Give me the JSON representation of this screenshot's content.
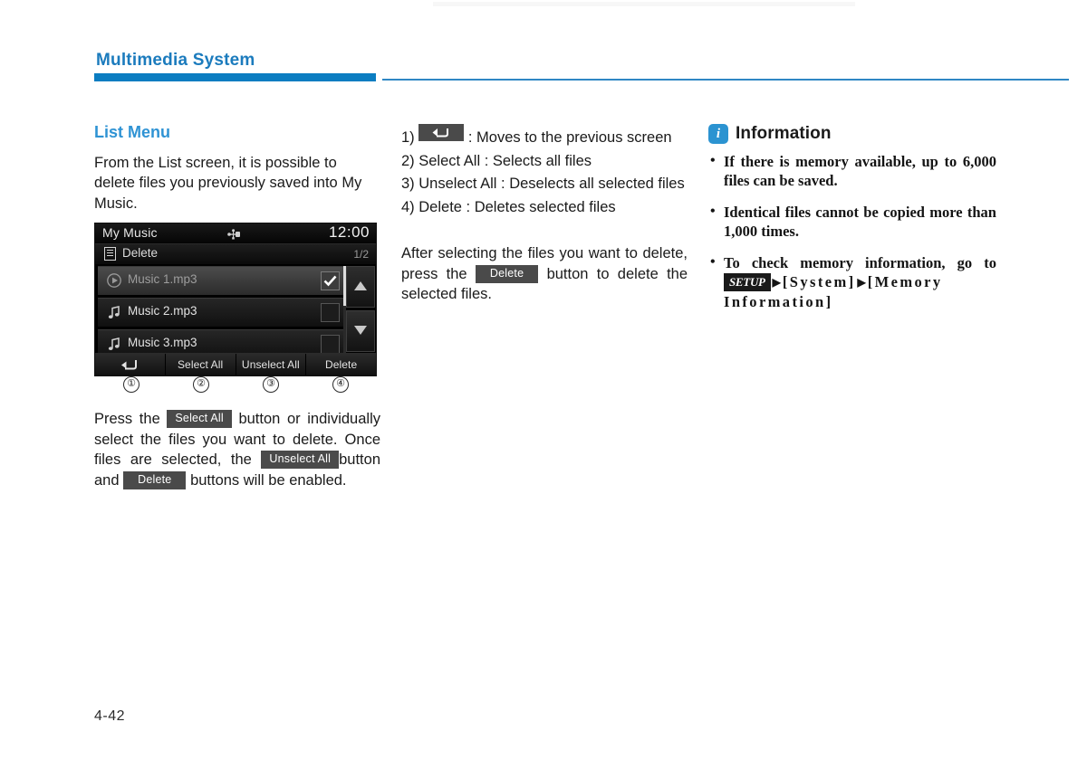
{
  "header": {
    "title": "Multimedia System"
  },
  "left": {
    "section_title": "List Menu",
    "intro": "From the List screen, it is possible to delete files you previously saved into My Music.",
    "under_device": {
      "part1": "Press the",
      "chip_select_all": "Select All",
      "part2": "button or individually select the files you want to delete. Once files are selected, the",
      "chip_unselect_all": "Unselect All",
      "part3": "button and",
      "chip_delete": "Delete",
      "part4": "buttons will be enabled."
    }
  },
  "device": {
    "title": "My Music",
    "usb_icon": "usb-icon",
    "clock": "12:00",
    "submenu_icon": "list-menu-icon",
    "submenu_label": "Delete",
    "page_indicator": "1/2",
    "rows": [
      {
        "label": "Music 1.mp3",
        "icon": "play-circle-icon",
        "checked": true,
        "selected": true
      },
      {
        "label": "Music 2.mp3",
        "icon": "music-note-icon",
        "checked": false,
        "selected": false
      },
      {
        "label": "Music 3.mp3",
        "icon": "music-note-icon",
        "checked": false,
        "selected": false
      }
    ],
    "scroll_up_icon": "arrow-up-icon",
    "scroll_down_icon": "arrow-down-icon",
    "buttons": [
      {
        "label": "",
        "icon": "back-arrow-icon"
      },
      {
        "label": "Select All",
        "icon": ""
      },
      {
        "label": "Unselect All",
        "icon": ""
      },
      {
        "label": "Delete",
        "icon": ""
      }
    ]
  },
  "callouts": [
    {
      "number": "①"
    },
    {
      "number": "②"
    },
    {
      "number": "③"
    },
    {
      "number": "④"
    }
  ],
  "middle": {
    "item1_num": "1)",
    "item1_chip_icon": "back-arrow-icon",
    "item1_text": ": Moves to the previous screen",
    "item2": "2) Select All : Selects all files",
    "item3": "3) Unselect All : Deselects all selected files",
    "item4": "4) Delete : Deletes selected files",
    "paragraph": {
      "part1": "After selecting the files you want to delete, press the",
      "chip_delete": "Delete",
      "part2": "button to delete the selected files."
    }
  },
  "info": {
    "icon": "info-icon",
    "title": "Information",
    "items": [
      "If there is memory available, up to 6,000 files can be saved.",
      "Identical files cannot be copied more than 1,000 times."
    ],
    "last_item": {
      "part1": "To check memory information, go to",
      "setup_chip": "SETUP",
      "arrow": "▶",
      "system": "[System]",
      "memory": "[Memory Information]"
    }
  },
  "footer": {
    "page_number": "4-42"
  },
  "colors": {
    "accent_blue": "#0b7dc1",
    "title_blue": "#2f93d4",
    "info_icon_blue": "#2b93d1",
    "chip_gray": "#4a4a4a"
  }
}
